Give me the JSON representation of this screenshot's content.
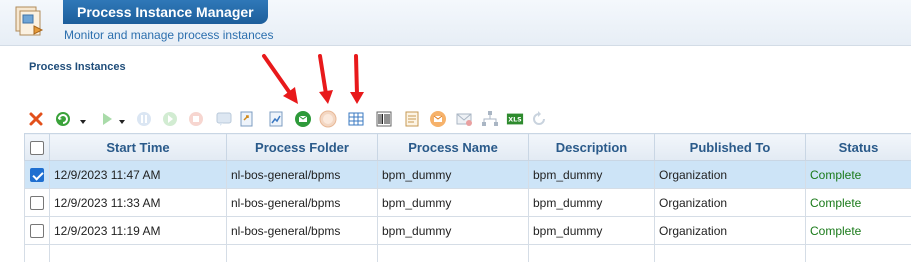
{
  "header": {
    "title": "Process Instance Manager",
    "subtitle": "Monitor and manage process instances"
  },
  "section": {
    "title": "Process Instances"
  },
  "toolbar": {
    "icons": [
      "delete-icon",
      "refresh-icon",
      "play-icon",
      "pause-icon",
      "resume-icon",
      "stop-icon",
      "comment-icon",
      "export-icon",
      "report-icon",
      "email-green-icon",
      "email-disabled-icon",
      "details-grid-icon",
      "barcode-icon",
      "document-icon",
      "email-orange-icon",
      "email-gray-icon",
      "hierarchy-icon",
      "excel-icon",
      "reload-icon"
    ],
    "excel_label": "XLS"
  },
  "table": {
    "columns": [
      "Start Time",
      "Process Folder",
      "Process Name",
      "Description",
      "Published To",
      "Status"
    ],
    "rows": [
      {
        "selected": true,
        "start_time": "12/9/2023 11:47 AM",
        "folder": "nl-bos-general/bpms",
        "name": "bpm_dummy",
        "description": "bpm_dummy",
        "published_to": "Organization",
        "status": "Complete"
      },
      {
        "selected": false,
        "start_time": "12/9/2023 11:33 AM",
        "folder": "nl-bos-general/bpms",
        "name": "bpm_dummy",
        "description": "bpm_dummy",
        "published_to": "Organization",
        "status": "Complete"
      },
      {
        "selected": false,
        "start_time": "12/9/2023 11:19 AM",
        "folder": "nl-bos-general/bpms",
        "name": "bpm_dummy",
        "description": "bpm_dummy",
        "published_to": "Organization",
        "status": "Complete"
      }
    ]
  },
  "colors": {
    "accent": "#2c6fae",
    "selected_row": "#cde4f7",
    "status_complete": "#1a7a1a",
    "arrow": "#e8191b"
  }
}
